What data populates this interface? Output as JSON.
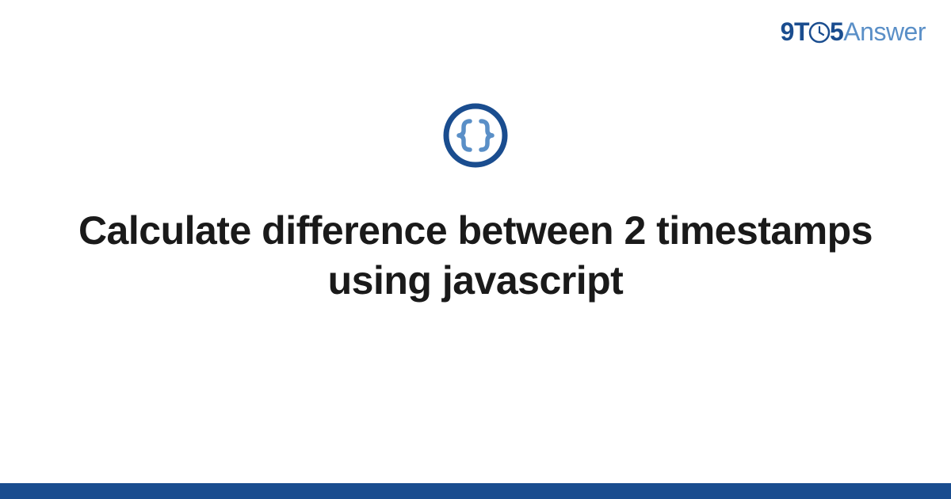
{
  "logo": {
    "part1": "9T",
    "part2": "5",
    "part3": "Answer"
  },
  "title": "Calculate difference between 2 timestamps using javascript",
  "colors": {
    "primary": "#1a4d8f",
    "secondary": "#5a8fc7",
    "text": "#1a1a1a"
  }
}
